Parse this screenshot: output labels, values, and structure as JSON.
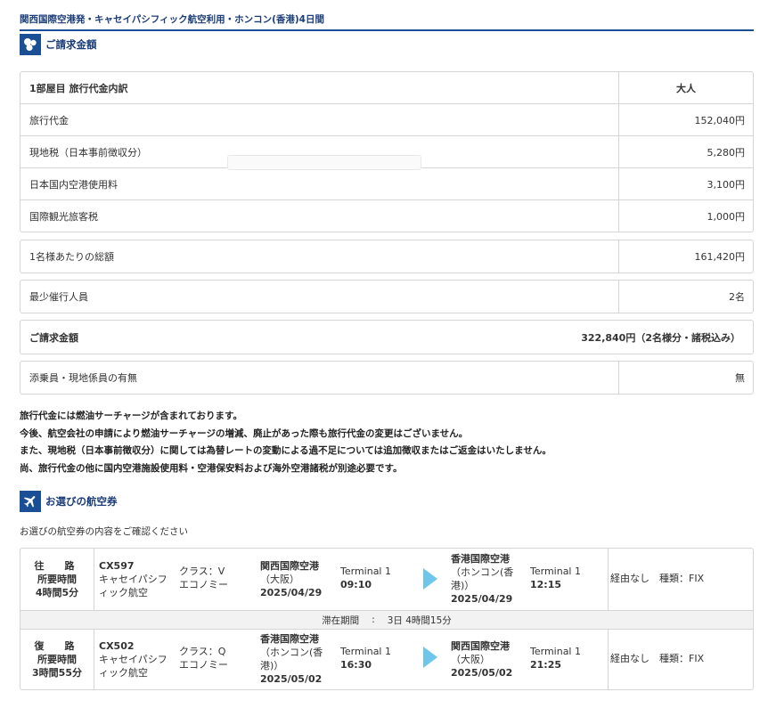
{
  "page_title": "関西国際空港発・キャセイパシフィック航空利用・ホンコン(香港)4日間",
  "billing_section": {
    "title": "ご請求金額",
    "icon": "coins-icon",
    "header_label": "1部屋目 旅行代金内訳",
    "header_value": "大人",
    "rows": [
      {
        "label": "旅行代金",
        "value": "152,040円"
      },
      {
        "label": "現地税（日本事前徴収分）",
        "value": "5,280円"
      },
      {
        "label": "日本国内空港使用料",
        "value": "3,100円"
      },
      {
        "label": "国際観光旅客税",
        "value": "1,000円"
      }
    ],
    "per_person_label": "1名様あたりの総額",
    "per_person_value": "161,420円",
    "min_people_label": "最少催行人員",
    "min_people_value": "2名",
    "total_label": "ご請求金額",
    "total_value": "322,840円（2名様分・諸税込み）",
    "escort_label": "添乗員・現地係員の有無",
    "escort_value": "無"
  },
  "notes": [
    "旅行代金には燃油サーチャージが含まれております。",
    "今後、航空会社の申請により燃油サーチャージの増減、廃止があった際も旅行代金の変更はございません。",
    "また、現地税（日本事前徴収分）に関しては為替レートの変動による過不足については追加徴収またはご返金はいたしません。",
    "尚、旅行代金の他に国内空港施設使用料・空港保安料および海外空港諸税が別途必要です。"
  ],
  "flight_section": {
    "title": "お選びの航空券",
    "icon": "airplane-icon",
    "subtitle": "お選びの航空券の内容をご確認ください",
    "outbound": {
      "direction": "往　路",
      "duration_label": "所要時間",
      "duration": "4時間5分",
      "flight_no": "CX597",
      "airline_line1": "キャセイパシフ",
      "airline_line2": "ィック航空",
      "class_line": "クラス：V",
      "cabin": "エコノミー",
      "dep_airport": "関西国際空港",
      "dep_city": "（大阪）",
      "dep_date": "2025/04/29",
      "dep_terminal": "Terminal 1",
      "dep_time": "09:10",
      "arr_airport": "香港国際空港",
      "arr_city_line1": "（ホンコン(香",
      "arr_city_line2": "港)）",
      "arr_date": "2025/04/29",
      "arr_terminal": "Terminal 1",
      "arr_time": "12:15",
      "via": "経由なし　種類：FIX"
    },
    "stay": {
      "label": "滞在期間",
      "sep": ":",
      "value": "3日 4時間15分"
    },
    "inbound": {
      "direction": "復　路",
      "duration_label": "所要時間",
      "duration": "3時間55分",
      "flight_no": "CX502",
      "airline_line1": "キャセイパシフ",
      "airline_line2": "ィック航空",
      "class_line": "クラス：Q",
      "cabin": "エコノミー",
      "dep_airport": "香港国際空港",
      "dep_city_line1": "（ホンコン(香",
      "dep_city_line2": "港)）",
      "dep_date": "2025/05/02",
      "dep_terminal": "Terminal 1",
      "dep_time": "16:30",
      "arr_airport": "関西国際空港",
      "arr_city": "（大阪）",
      "arr_date": "2025/05/02",
      "arr_terminal": "Terminal 1",
      "arr_time": "21:25",
      "via": "経由なし　種類：FIX"
    }
  },
  "colors": {
    "accent": "#1a4f96",
    "arrow": "#6ec6ea"
  }
}
